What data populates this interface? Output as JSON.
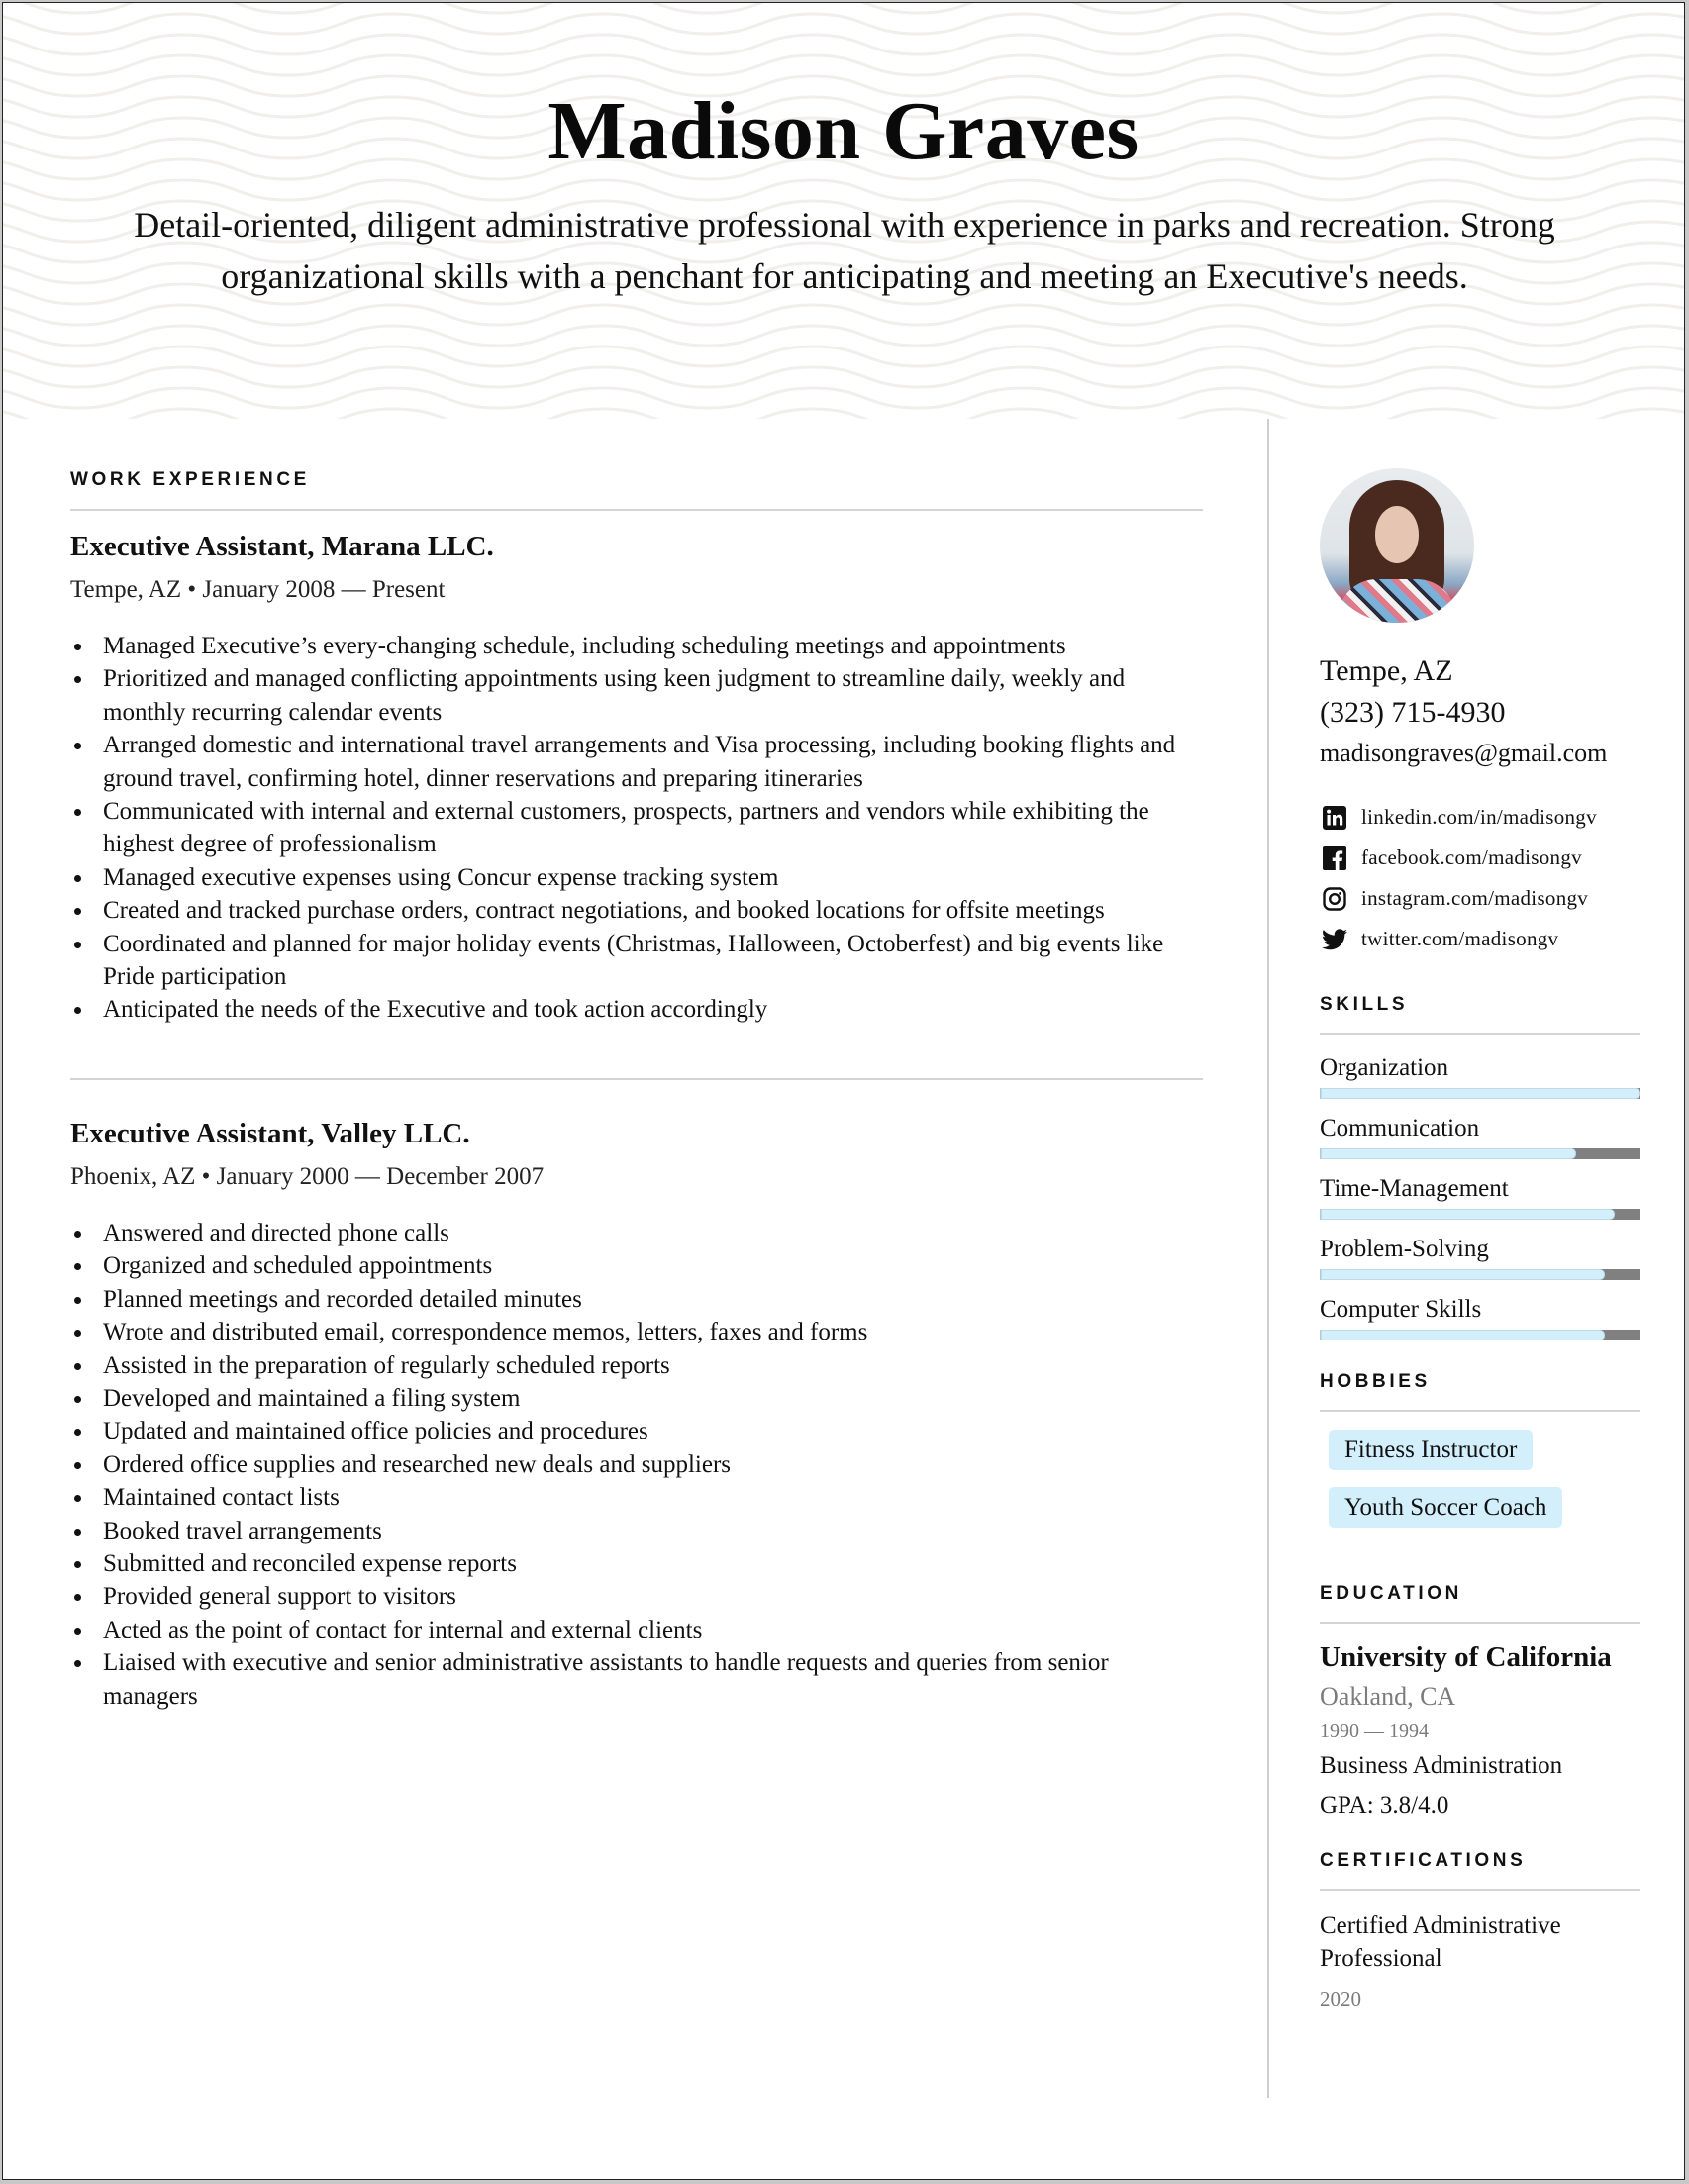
{
  "header": {
    "name": "Madison Graves",
    "summary": "Detail-oriented, diligent administrative professional with experience in parks and recreation. Strong organizational skills with a penchant for anticipating and meeting an Executive's needs."
  },
  "work_experience": {
    "label": "WORK EXPERIENCE",
    "jobs": [
      {
        "title": "Executive Assistant, Marana LLC.",
        "meta": "Tempe, AZ • January 2008 — Present",
        "bullets": [
          "Managed Executive’s every-changing schedule, including scheduling meetings and appointments",
          "Prioritized and managed conflicting appointments using keen judgment to streamline daily, weekly and monthly recurring calendar events",
          "Arranged domestic and international travel arrangements and Visa processing, including booking flights and ground travel, confirming hotel, dinner reservations and preparing itineraries",
          "Communicated with internal and external customers, prospects, partners and vendors while exhibiting the highest degree of professionalism",
          "Managed executive expenses using Concur expense tracking system",
          "Created and tracked purchase orders, contract negotiations, and booked locations for offsite meetings",
          "Coordinated and planned for major holiday events (Christmas, Halloween, Octoberfest) and big events like Pride participation",
          "Anticipated the needs of the Executive and took action accordingly"
        ]
      },
      {
        "title": "Executive Assistant, Valley LLC.",
        "meta": "Phoenix, AZ • January 2000 — December 2007",
        "bullets": [
          "Answered and directed phone calls",
          "Organized and scheduled appointments",
          "Planned meetings and recorded detailed minutes",
          "Wrote and distributed email, correspondence memos, letters, faxes and forms",
          "Assisted in the preparation of regularly scheduled reports",
          "Developed and maintained a filing system",
          "Updated and maintained office policies and procedures",
          "Ordered office supplies and researched new deals and suppliers",
          "Maintained contact lists",
          "Booked travel arrangements",
          "Submitted and reconciled expense reports",
          "Provided general support to visitors",
          "Acted as the point of contact for internal and external clients",
          "Liaised with executive and senior administrative assistants to handle requests and queries from senior managers"
        ]
      }
    ]
  },
  "contact": {
    "location": "Tempe, AZ",
    "phone": "(323) 715-4930",
    "email": "madisongraves@gmail.com",
    "socials": [
      {
        "icon": "linkedin-icon",
        "text": "linkedin.com/in/madisongv"
      },
      {
        "icon": "facebook-icon",
        "text": "facebook.com/madisongv"
      },
      {
        "icon": "instagram-icon",
        "text": "instagram.com/madisongv"
      },
      {
        "icon": "twitter-icon",
        "text": "twitter.com/madisongv"
      }
    ]
  },
  "skills": {
    "label": "SKILLS",
    "items": [
      {
        "name": "Organization",
        "level": 1.0
      },
      {
        "name": "Communication",
        "level": 0.8
      },
      {
        "name": "Time-Management",
        "level": 0.92
      },
      {
        "name": "Problem-Solving",
        "level": 0.89
      },
      {
        "name": "Computer Skills",
        "level": 0.89
      }
    ],
    "fill_color": "#d3effb",
    "track_color": "#808080"
  },
  "hobbies": {
    "label": "HOBBIES",
    "items": [
      "Fitness Instructor",
      "Youth Soccer Coach"
    ]
  },
  "education": {
    "label": "EDUCATION",
    "school": "University of California",
    "location": "Oakland, CA",
    "years": "1990 — 1994",
    "degree": "Business Administration",
    "gpa": "GPA: 3.8/4.0"
  },
  "certifications": {
    "label": "CERTIFICATIONS",
    "items": [
      {
        "name": "Certified Administrative Professional",
        "year": "2020"
      }
    ]
  }
}
